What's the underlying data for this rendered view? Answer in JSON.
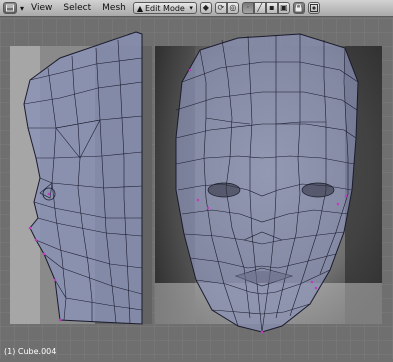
{
  "toolbar": {
    "view_menu": "View",
    "select_menu": "Select",
    "mesh_menu": "Mesh",
    "mode_label": "Edit Mode",
    "icons": [
      "editor-type-icon",
      "collapse-arrow-icon",
      "mode-icon",
      "pivot-icon",
      "manipulator-icon",
      "proportional-edit-icon",
      "vertex-select-icon",
      "edge-select-icon",
      "face-select-icon",
      "occlude-background-icon",
      "lock-icon",
      "render-icon"
    ]
  },
  "viewport": {
    "status_text": "(1) Cube.004",
    "colors": {
      "background": "#6f6f6f",
      "grid": "#7d7d7d",
      "mesh_fill": "#8892b5",
      "wire": "#1b1b2e",
      "vertex": "#c03cc0"
    }
  }
}
